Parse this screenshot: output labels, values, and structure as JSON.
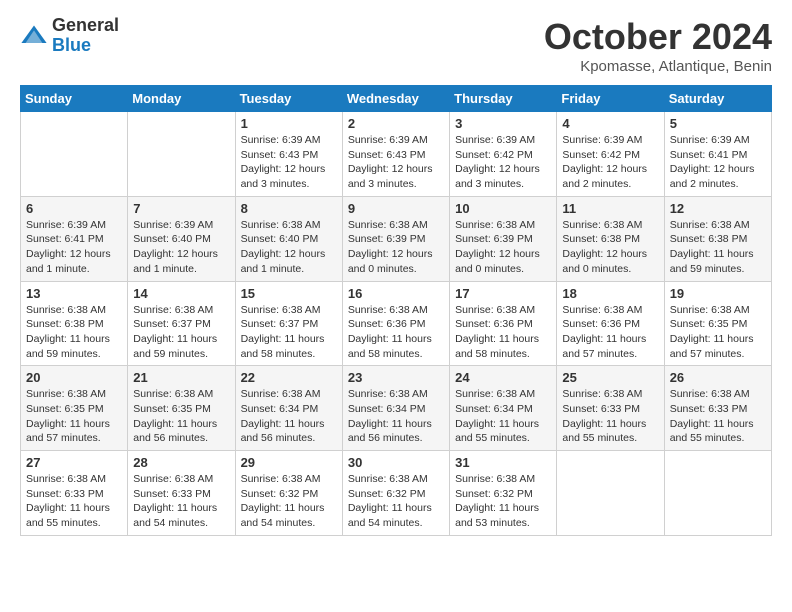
{
  "logo": {
    "general": "General",
    "blue": "Blue"
  },
  "title": "October 2024",
  "subtitle": "Kpomasse, Atlantique, Benin",
  "days_of_week": [
    "Sunday",
    "Monday",
    "Tuesday",
    "Wednesday",
    "Thursday",
    "Friday",
    "Saturday"
  ],
  "weeks": [
    [
      {
        "day": "",
        "info": ""
      },
      {
        "day": "",
        "info": ""
      },
      {
        "day": "1",
        "info": "Sunrise: 6:39 AM\nSunset: 6:43 PM\nDaylight: 12 hours and 3 minutes."
      },
      {
        "day": "2",
        "info": "Sunrise: 6:39 AM\nSunset: 6:43 PM\nDaylight: 12 hours and 3 minutes."
      },
      {
        "day": "3",
        "info": "Sunrise: 6:39 AM\nSunset: 6:42 PM\nDaylight: 12 hours and 3 minutes."
      },
      {
        "day": "4",
        "info": "Sunrise: 6:39 AM\nSunset: 6:42 PM\nDaylight: 12 hours and 2 minutes."
      },
      {
        "day": "5",
        "info": "Sunrise: 6:39 AM\nSunset: 6:41 PM\nDaylight: 12 hours and 2 minutes."
      }
    ],
    [
      {
        "day": "6",
        "info": "Sunrise: 6:39 AM\nSunset: 6:41 PM\nDaylight: 12 hours and 1 minute."
      },
      {
        "day": "7",
        "info": "Sunrise: 6:39 AM\nSunset: 6:40 PM\nDaylight: 12 hours and 1 minute."
      },
      {
        "day": "8",
        "info": "Sunrise: 6:38 AM\nSunset: 6:40 PM\nDaylight: 12 hours and 1 minute."
      },
      {
        "day": "9",
        "info": "Sunrise: 6:38 AM\nSunset: 6:39 PM\nDaylight: 12 hours and 0 minutes."
      },
      {
        "day": "10",
        "info": "Sunrise: 6:38 AM\nSunset: 6:39 PM\nDaylight: 12 hours and 0 minutes."
      },
      {
        "day": "11",
        "info": "Sunrise: 6:38 AM\nSunset: 6:38 PM\nDaylight: 12 hours and 0 minutes."
      },
      {
        "day": "12",
        "info": "Sunrise: 6:38 AM\nSunset: 6:38 PM\nDaylight: 11 hours and 59 minutes."
      }
    ],
    [
      {
        "day": "13",
        "info": "Sunrise: 6:38 AM\nSunset: 6:38 PM\nDaylight: 11 hours and 59 minutes."
      },
      {
        "day": "14",
        "info": "Sunrise: 6:38 AM\nSunset: 6:37 PM\nDaylight: 11 hours and 59 minutes."
      },
      {
        "day": "15",
        "info": "Sunrise: 6:38 AM\nSunset: 6:37 PM\nDaylight: 11 hours and 58 minutes."
      },
      {
        "day": "16",
        "info": "Sunrise: 6:38 AM\nSunset: 6:36 PM\nDaylight: 11 hours and 58 minutes."
      },
      {
        "day": "17",
        "info": "Sunrise: 6:38 AM\nSunset: 6:36 PM\nDaylight: 11 hours and 58 minutes."
      },
      {
        "day": "18",
        "info": "Sunrise: 6:38 AM\nSunset: 6:36 PM\nDaylight: 11 hours and 57 minutes."
      },
      {
        "day": "19",
        "info": "Sunrise: 6:38 AM\nSunset: 6:35 PM\nDaylight: 11 hours and 57 minutes."
      }
    ],
    [
      {
        "day": "20",
        "info": "Sunrise: 6:38 AM\nSunset: 6:35 PM\nDaylight: 11 hours and 57 minutes."
      },
      {
        "day": "21",
        "info": "Sunrise: 6:38 AM\nSunset: 6:35 PM\nDaylight: 11 hours and 56 minutes."
      },
      {
        "day": "22",
        "info": "Sunrise: 6:38 AM\nSunset: 6:34 PM\nDaylight: 11 hours and 56 minutes."
      },
      {
        "day": "23",
        "info": "Sunrise: 6:38 AM\nSunset: 6:34 PM\nDaylight: 11 hours and 56 minutes."
      },
      {
        "day": "24",
        "info": "Sunrise: 6:38 AM\nSunset: 6:34 PM\nDaylight: 11 hours and 55 minutes."
      },
      {
        "day": "25",
        "info": "Sunrise: 6:38 AM\nSunset: 6:33 PM\nDaylight: 11 hours and 55 minutes."
      },
      {
        "day": "26",
        "info": "Sunrise: 6:38 AM\nSunset: 6:33 PM\nDaylight: 11 hours and 55 minutes."
      }
    ],
    [
      {
        "day": "27",
        "info": "Sunrise: 6:38 AM\nSunset: 6:33 PM\nDaylight: 11 hours and 55 minutes."
      },
      {
        "day": "28",
        "info": "Sunrise: 6:38 AM\nSunset: 6:33 PM\nDaylight: 11 hours and 54 minutes."
      },
      {
        "day": "29",
        "info": "Sunrise: 6:38 AM\nSunset: 6:32 PM\nDaylight: 11 hours and 54 minutes."
      },
      {
        "day": "30",
        "info": "Sunrise: 6:38 AM\nSunset: 6:32 PM\nDaylight: 11 hours and 54 minutes."
      },
      {
        "day": "31",
        "info": "Sunrise: 6:38 AM\nSunset: 6:32 PM\nDaylight: 11 hours and 53 minutes."
      },
      {
        "day": "",
        "info": ""
      },
      {
        "day": "",
        "info": ""
      }
    ]
  ]
}
